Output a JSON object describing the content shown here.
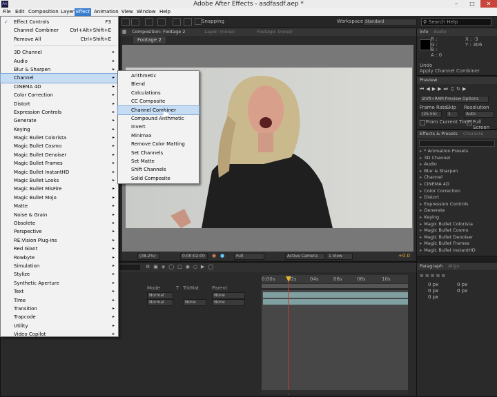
{
  "window": {
    "title": "Adobe After Effects - asdfasdf.aep *",
    "logo": "Ae",
    "controls": [
      "minimize-icon",
      "maximize-icon",
      "close-icon"
    ]
  },
  "menubar": [
    "File",
    "Edit",
    "Composition",
    "Layer",
    "Effect",
    "Animation",
    "View",
    "Window",
    "Help"
  ],
  "effect_menu": {
    "top": [
      {
        "label": "Effect Controls",
        "shortcut": "F3",
        "checked": true
      },
      {
        "label": "Channel Combiner",
        "shortcut": "Ctrl+Alt+Shift+E"
      },
      {
        "label": "Remove All",
        "shortcut": "Ctrl+Shift+E"
      }
    ],
    "categories": [
      "3D Channel",
      "Audio",
      "Blur & Sharpen",
      "Channel",
      "CINEMA 4D",
      "Color Correction",
      "Distort",
      "Expression Controls",
      "Generate",
      "Keying",
      "Magic Bullet Colorista",
      "Magic Bullet Cosmo",
      "Magic Bullet Denoiser",
      "Magic Bullet Frames",
      "Magic Bullet InstantHD",
      "Magic Bullet Looks",
      "Magic Bullet MisFire",
      "Magic Bullet Mojo",
      "Matte",
      "Noise & Grain",
      "Obsolete",
      "Perspective",
      "RE:Vision Plug-ins",
      "Red Giant",
      "Rowbyte",
      "Simulation",
      "Stylize",
      "Synthetic Aperture",
      "Text",
      "Time",
      "Transition",
      "Trapcode",
      "Utility",
      "Video Copilot"
    ],
    "selected_category": "Channel"
  },
  "channel_submenu": [
    "Arithmetic",
    "Blend",
    "Calculations",
    "CC Composite",
    "Channel Combiner",
    "Compound Arithmetic",
    "Invert",
    "Minimax",
    "Remove Color Matting",
    "Set Channels",
    "Set Matte",
    "Shift Channels",
    "Solid Composite"
  ],
  "channel_submenu_selected": "Channel Combiner",
  "toolbar": {
    "snapping": "Snapping",
    "workspace_label": "Workspace:",
    "workspace_value": "Standard",
    "search_placeholder": "Search Help"
  },
  "comp_panel": {
    "tabs": [
      "Composition: Footage 2",
      "Layer: (none)",
      "Footage: (none)"
    ],
    "sub_tab": "Footage 2"
  },
  "viewer_footer": {
    "zoom": "(38.2%)",
    "timecode": "0:00:02:00",
    "resolution": "Full",
    "camera": "Active Camera",
    "view": "1 View",
    "exposure": "+0.0"
  },
  "info_panel": {
    "tabs": [
      "Info",
      "Audio"
    ],
    "r": "R :",
    "g": "G :",
    "b": "B :",
    "a": "A : 0",
    "x": "X : -3",
    "y": "Y : 306",
    "undo": "Undo",
    "undo_action": "Apply Channel Combiner"
  },
  "preview_panel": {
    "title": "Preview",
    "options": "Shift+RAM Preview Options",
    "frame_rate_label": "Frame Rate",
    "skip_label": "Skip",
    "resolution_label": "Resolution",
    "frame_rate": "(25.55)",
    "skip": "1",
    "resolution": "Auto",
    "from_current": "From Current Time",
    "full_screen": "Full Screen"
  },
  "effects_presets": {
    "tabs": [
      "Effects & Presets",
      "Characte"
    ],
    "items": [
      "* Animation Presets",
      "3D Channel",
      "Audio",
      "Blur & Sharpen",
      "Channel",
      "CINEMA 4D",
      "Color Correction",
      "Distort",
      "Expression Controls",
      "Generate",
      "Keying",
      "Magic Bullet Colorista",
      "Magic Bullet Cosmo",
      "Magic Bullet Denoiser",
      "Magic Bullet Frames",
      "Magic Bullet InstantHD"
    ]
  },
  "paragraph_panel": {
    "tabs": [
      "Paragraph",
      "Align"
    ],
    "values": [
      "0 px",
      "0 px",
      "0 px",
      "0 px",
      "0 px"
    ]
  },
  "timeline": {
    "columns": [
      "Mode",
      "T",
      "TrkMat",
      "Parent"
    ],
    "rows": [
      {
        "mode": "Normal",
        "trkmat": "",
        "parent": "None"
      },
      {
        "mode": "Normal",
        "trkmat": "None",
        "parent": "None"
      }
    ],
    "ticks": [
      "0:00s",
      "02s",
      "04s",
      "06s",
      "08s",
      "10s"
    ]
  },
  "colors": {
    "menu_highlight": "#c6dcf3",
    "accent": "#3b7fd1",
    "playhead": "#d2372b",
    "track": "#7f9fa0"
  }
}
